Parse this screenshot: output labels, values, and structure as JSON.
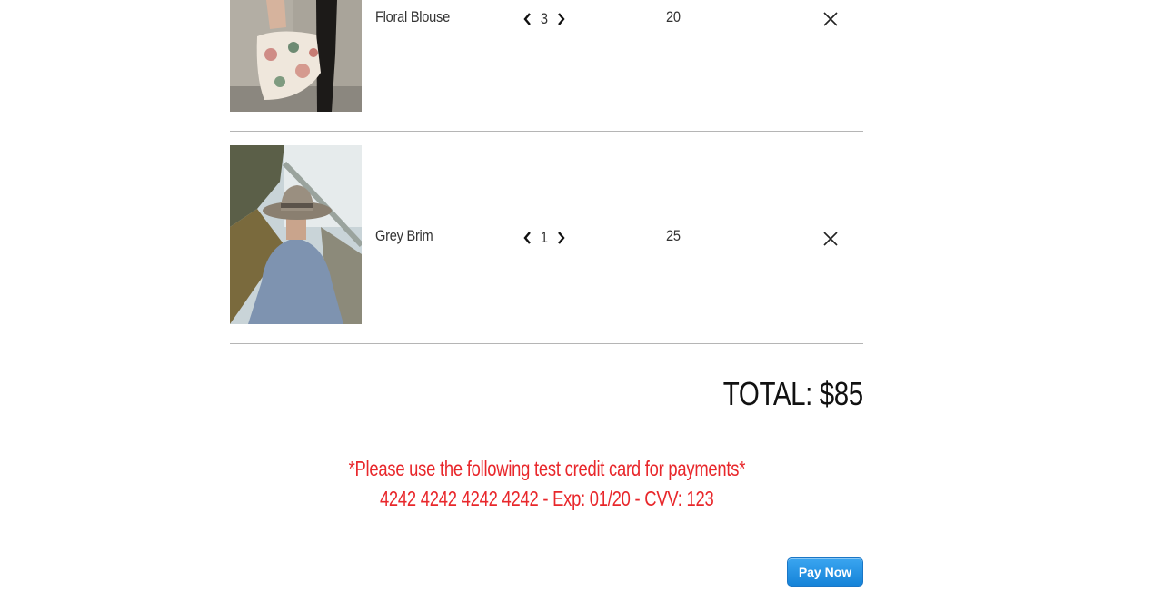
{
  "cart": {
    "items": [
      {
        "name": "Floral Blouse",
        "quantity": "3",
        "price": "20",
        "image": "floral-blouse-photo"
      },
      {
        "name": "Grey Brim",
        "quantity": "1",
        "price": "25",
        "image": "grey-brim-hat-photo"
      }
    ],
    "total_label": "TOTAL: $85"
  },
  "notice": {
    "line1": "*Please use the following test credit card for payments*",
    "line2": "4242 4242 4242 4242 - Exp: 01/20 - CVV: 123",
    "color": "#e8272b"
  },
  "pay_button": {
    "label": "Pay Now",
    "color": "#1f8fe0"
  },
  "icons": {
    "decrease": "chevron-left-icon",
    "increase": "chevron-right-icon",
    "remove": "close-icon"
  }
}
